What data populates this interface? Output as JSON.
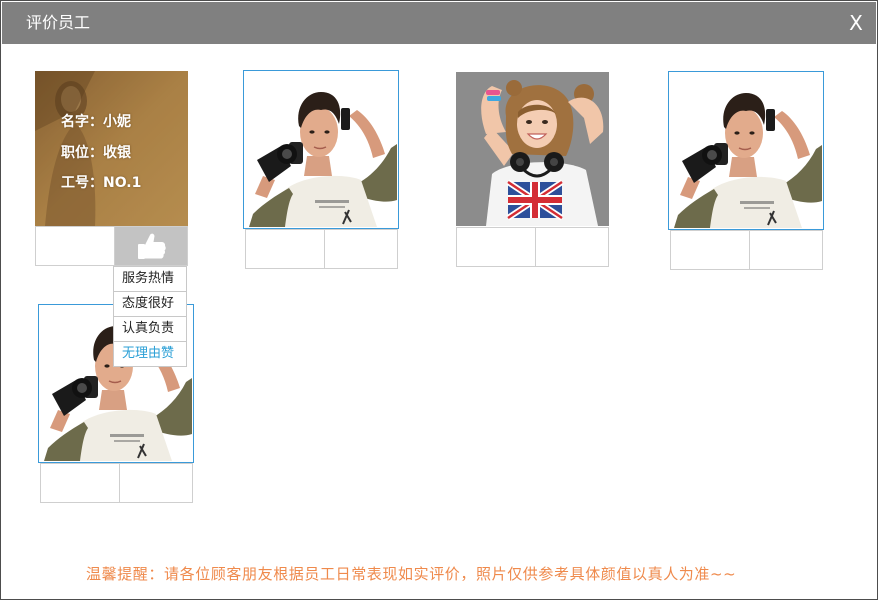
{
  "dialog": {
    "title": "评价员工",
    "close_label": "X"
  },
  "colors": {
    "title_bar": "#808080",
    "photo_border": "#3a9ad9",
    "thumbs_up": "#1f5aa6",
    "thumbs_down": "#555555",
    "active_cell": "#c3c3c3",
    "menu_highlight": "#2a9fd6",
    "footer_text": "#ef8a4c"
  },
  "icons": {
    "like": "thumbs-up-icon",
    "dislike": "thumbs-down-icon"
  },
  "employees": [
    {
      "info_lines": [
        "名字：小妮",
        "职位：收银",
        "工号：NO.1"
      ]
    }
  ],
  "reason_menu": {
    "items": [
      "服务热情",
      "态度很好",
      "认真负责",
      "无理由赞"
    ]
  },
  "footer": {
    "notice": "温馨提醒：请各位顾客朋友根据员工日常表现如实评价，照片仅供参考具体颜值以真人为准~~"
  }
}
